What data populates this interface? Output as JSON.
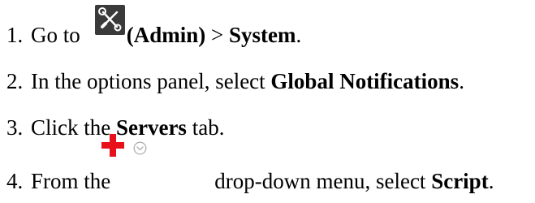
{
  "steps": [
    {
      "number": "1.",
      "pre": "Go to",
      "bold1": "(Admin)",
      "mid": " > ",
      "bold2": "System",
      "post": ".",
      "icon": "admin-tools-icon"
    },
    {
      "number": "2.",
      "pre": "In the options panel, select ",
      "bold1": "Global Notifications",
      "post": "."
    },
    {
      "number": "3.",
      "pre": "Click the ",
      "bold1": "Servers",
      "post": " tab."
    },
    {
      "number": "4.",
      "pre": "From the",
      "mid": "drop-down menu, select ",
      "bold1": "Script",
      "post": ".",
      "icons": [
        "plus-icon",
        "chevron-down-icon"
      ]
    }
  ],
  "colors": {
    "admin_icon_bg": "#3a3a3a",
    "plus_red": "#e8101a",
    "chevron_gray": "#b0b0b0"
  }
}
